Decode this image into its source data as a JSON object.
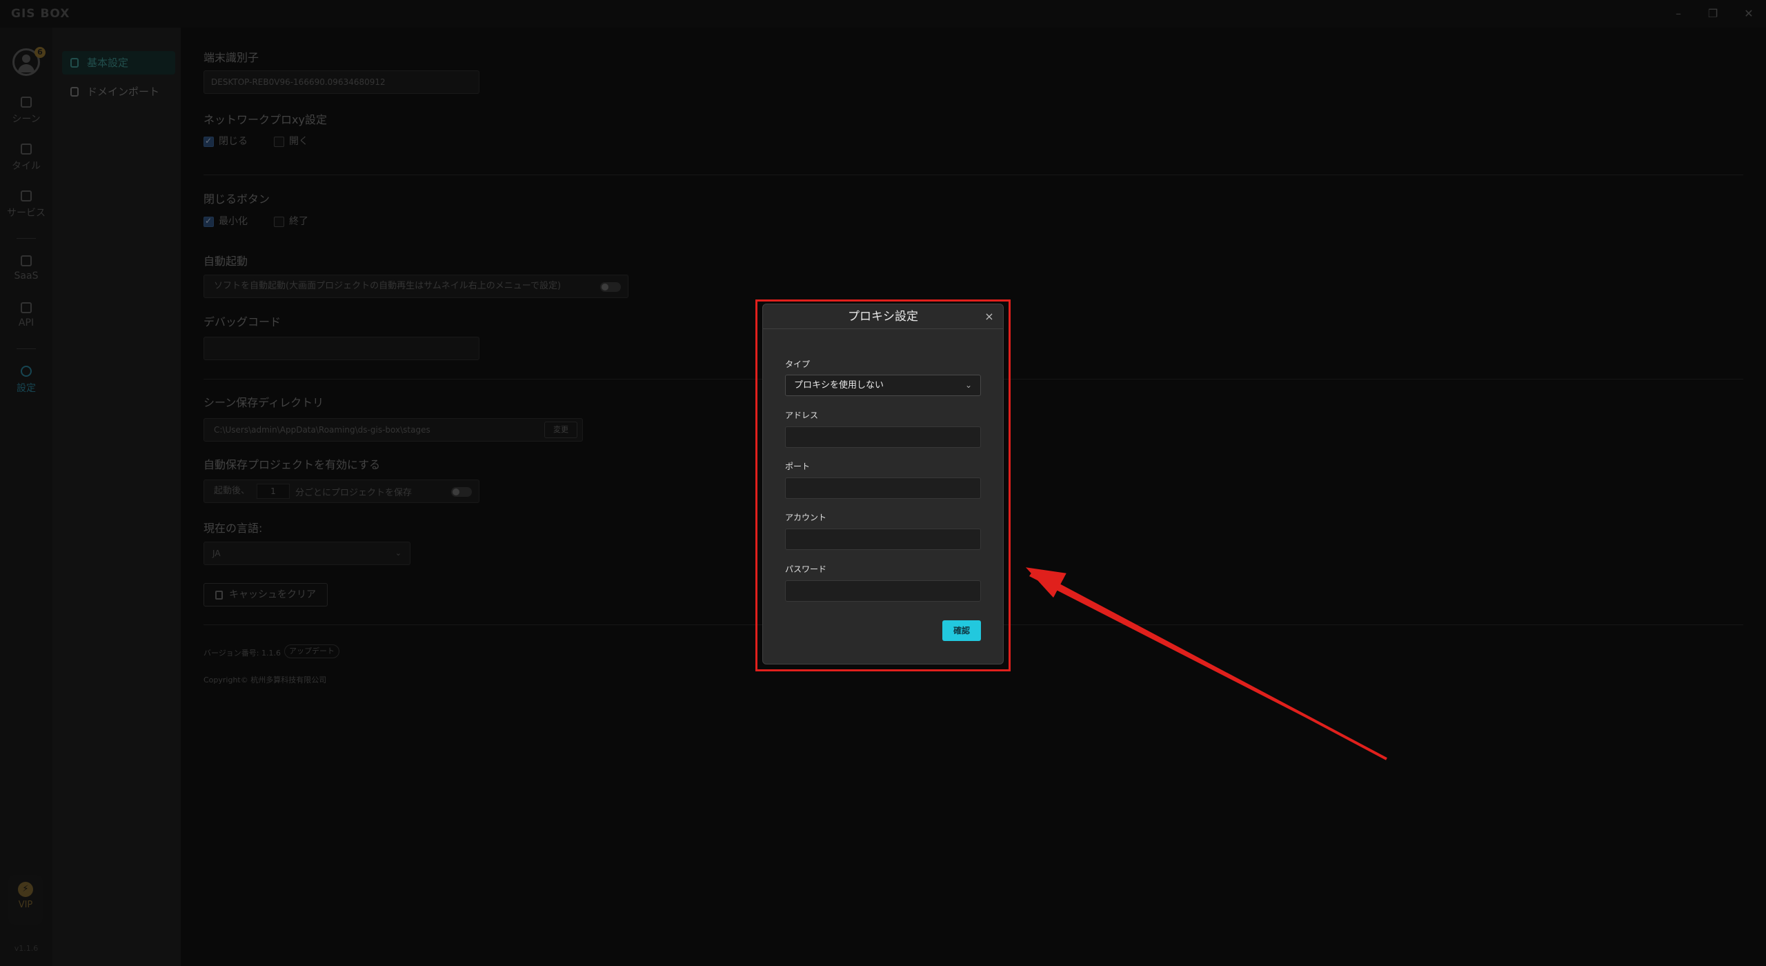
{
  "app": {
    "logo": "GIS BOX"
  },
  "window": {
    "minimize": "–",
    "restore": "❐",
    "close": "✕"
  },
  "rail": {
    "badge": "6",
    "items": [
      {
        "label": "シーン",
        "icon": "scene-icon"
      },
      {
        "label": "タイル",
        "icon": "tile-icon"
      },
      {
        "label": "サービス",
        "icon": "service-icon"
      },
      {
        "label": "SaaS",
        "icon": "saas-icon"
      },
      {
        "label": "API",
        "icon": "api-icon"
      },
      {
        "label": "設定",
        "icon": "settings-icon"
      }
    ],
    "vip": "VIP",
    "version": "v1.1.6"
  },
  "subnav": {
    "items": [
      {
        "label": "基本設定"
      },
      {
        "label": "ドメインポート"
      }
    ]
  },
  "settings": {
    "terminal_id_label": "端末識別子",
    "terminal_id_value": "DESKTOP-REB0V96-166690.09634680912",
    "proxy_label": "ネットワークプロxy設定",
    "proxy_close": "閉じる",
    "proxy_open": "開く",
    "close_button_label": "閉じるボタン",
    "minimize": "最小化",
    "exit": "終了",
    "autostart_label": "自動起動",
    "autostart_text": "ソフトを自動起動(大画面プロジェクトの自動再生はサムネイル右上のメニューで設定)",
    "debug_label": "デバッグコード",
    "scene_dir_label": "シーン保存ディレクトリ",
    "scene_dir_value": "C:\\Users\\admin\\AppData\\Roaming\\ds-gis-box\\stages",
    "scene_dir_change": "変更",
    "autosave_label": "自動保存プロジェクトを有効にする",
    "autosave_prefix": "起動後、",
    "autosave_value": "1",
    "autosave_suffix": "分ごとにプロジェクトを保存",
    "language_label": "現在の言語:",
    "language_value": "JA",
    "clear_cache": "キャッシュをクリア",
    "version_text": "バージョン番号: 1.1.6",
    "update": "アップデート",
    "copyright": "Copyright© 杭州多算科技有限公司"
  },
  "modal": {
    "title": "プロキシ設定",
    "close": "×",
    "type_label": "タイプ",
    "type_value": "プロキシを使用しない",
    "address_label": "アドレス",
    "port_label": "ポート",
    "account_label": "アカウント",
    "password_label": "パスワード",
    "confirm": "確認"
  },
  "colors": {
    "accent": "#22c8de",
    "highlight": "#e0201c"
  }
}
